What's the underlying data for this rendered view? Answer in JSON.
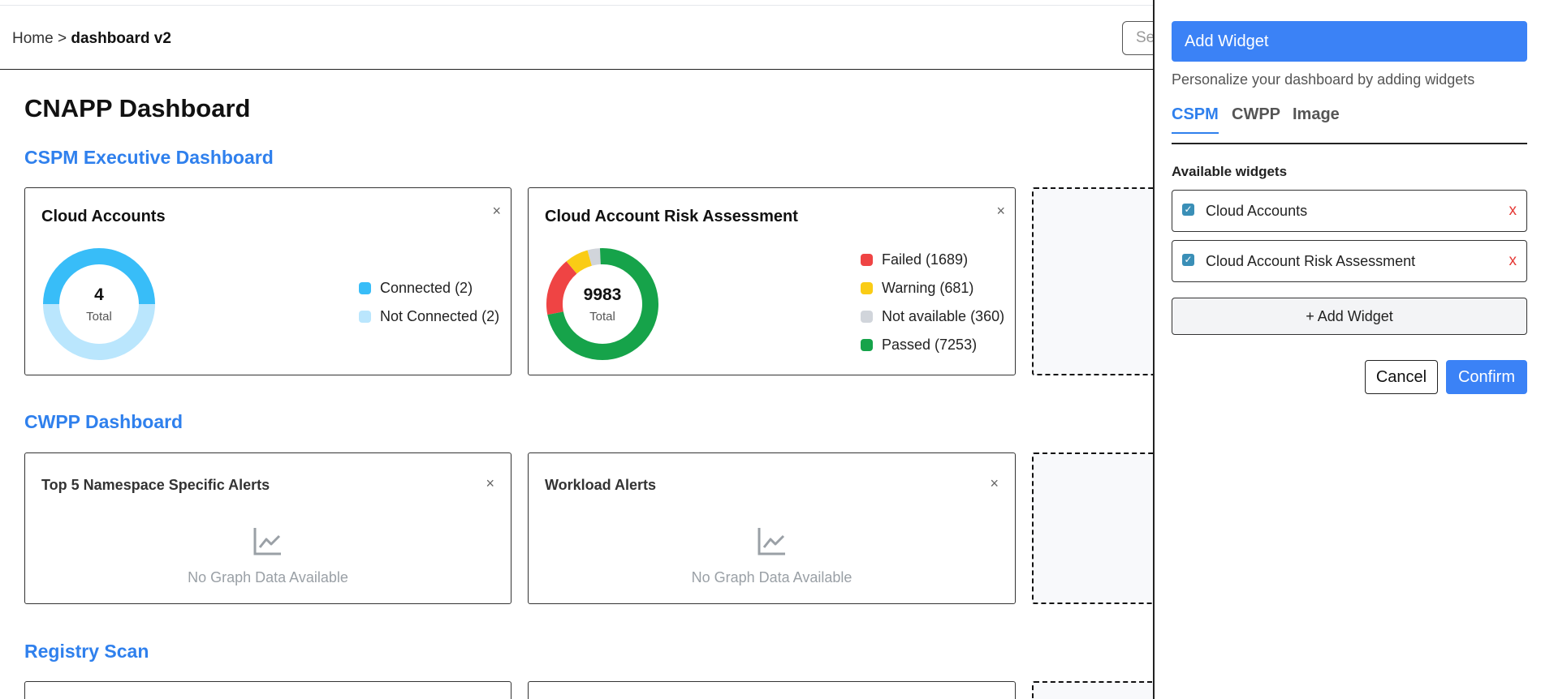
{
  "header": {
    "breadcrumb_home": "Home",
    "breadcrumb_sep": ">",
    "breadcrumb_current": "dashboard v2",
    "search_visible_text": "Se"
  },
  "main": {
    "page_title": "CNAPP Dashboard",
    "sections": {
      "cspm_title": "CSPM Executive Dashboard",
      "cwpp_title": "CWPP Dashboard",
      "registry_title": "Registry Scan"
    },
    "cloud_accounts": {
      "title": "Cloud Accounts",
      "close": "×",
      "total": "4",
      "total_label": "Total",
      "legend": [
        {
          "label": "Connected (2)",
          "color": "#38bdf8"
        },
        {
          "label": "Not Connected (2)",
          "color": "#bae6fd"
        }
      ]
    },
    "risk_assessment": {
      "title": "Cloud Account Risk Assessment",
      "close": "×",
      "total": "9983",
      "total_label": "Total",
      "legend": [
        {
          "label": "Failed (1689)",
          "color": "#ef4444"
        },
        {
          "label": "Warning (681)",
          "color": "#facc15"
        },
        {
          "label": "Not available (360)",
          "color": "#d1d5db"
        },
        {
          "label": "Passed (7253)",
          "color": "#16a34a"
        }
      ]
    },
    "namespace_alerts": {
      "title": "Top 5 Namespace Specific Alerts",
      "close": "×",
      "nodata": "No Graph Data Available"
    },
    "workload_alerts": {
      "title": "Workload Alerts",
      "close": "×",
      "nodata": "No Graph Data Available"
    }
  },
  "chart_data": [
    {
      "type": "pie",
      "title": "Cloud Accounts",
      "categories": [
        "Connected",
        "Not Connected"
      ],
      "values": [
        2,
        2
      ],
      "colors": [
        "#38bdf8",
        "#bae6fd"
      ]
    },
    {
      "type": "pie",
      "title": "Cloud Account Risk Assessment",
      "categories": [
        "Failed",
        "Warning",
        "Not available",
        "Passed"
      ],
      "values": [
        1689,
        681,
        360,
        7253
      ],
      "colors": [
        "#ef4444",
        "#facc15",
        "#d1d5db",
        "#16a34a"
      ]
    }
  ],
  "panel": {
    "title": "Add Widget",
    "subtitle": "Personalize your dashboard by adding widgets",
    "tabs": [
      {
        "label": "CSPM",
        "active": true
      },
      {
        "label": "CWPP",
        "active": false
      },
      {
        "label": "Image",
        "active": false
      }
    ],
    "available_label": "Available widgets",
    "widgets": [
      {
        "label": "Cloud Accounts",
        "checked": true,
        "remove": "x"
      },
      {
        "label": "Cloud Account Risk Assessment",
        "checked": true,
        "remove": "x"
      }
    ],
    "add_widget_label": "+ Add Widget",
    "cancel_label": "Cancel",
    "confirm_label": "Confirm"
  },
  "colors": {
    "accent": "#3b82f6",
    "section_title": "#2f80ed",
    "remove": "#e53935"
  }
}
